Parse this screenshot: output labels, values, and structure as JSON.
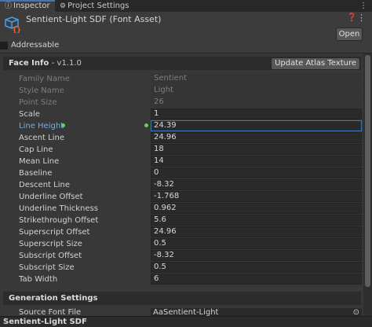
{
  "tabs": [
    {
      "label": "Inspector",
      "icon": "info-icon"
    },
    {
      "label": "Project Settings",
      "icon": "gear-icon"
    }
  ],
  "asset": {
    "title": "Sentient-Light SDF (Font Asset)",
    "open_label": "Open",
    "addressable_label": "Addressable",
    "addressable_checked": false
  },
  "face_info": {
    "title": "Face Info",
    "version": "- v1.1.0",
    "update_atlas_label": "Update Atlas Texture",
    "properties": [
      {
        "label": "Family Name",
        "value": "Sentient",
        "disabled": true
      },
      {
        "label": "Style Name",
        "value": "Light",
        "disabled": true
      },
      {
        "label": "Point Size",
        "value": "26",
        "disabled": true
      },
      {
        "label": "Scale",
        "value": "1"
      },
      {
        "label": "Line Height",
        "value": "24.39",
        "selected": true
      },
      {
        "label": "Ascent Line",
        "value": "24.96"
      },
      {
        "label": "Cap Line",
        "value": "18"
      },
      {
        "label": "Mean Line",
        "value": "14"
      },
      {
        "label": "Baseline",
        "value": "0"
      },
      {
        "label": "Descent Line",
        "value": "-8.32"
      },
      {
        "label": "Underline Offset",
        "value": "-1.768"
      },
      {
        "label": "Underline Thickness",
        "value": "0.962"
      },
      {
        "label": "Strikethrough Offset",
        "value": "5.6"
      },
      {
        "label": "Superscript Offset",
        "value": "24.96"
      },
      {
        "label": "Superscript Size",
        "value": "0.5"
      },
      {
        "label": "Subscript Offset",
        "value": "-8.32"
      },
      {
        "label": "Subscript Size",
        "value": "0.5"
      },
      {
        "label": "Tab Width",
        "value": "6"
      }
    ]
  },
  "generation": {
    "title": "Generation Settings",
    "source_font_label": "Source Font File",
    "source_font_value": "Sentient-Light"
  },
  "footer": {
    "label": "Sentient-Light SDF"
  },
  "colors": {
    "background": "#383838",
    "selected_label": "#7aa9e6",
    "selected_border": "#3e73b4",
    "override_dot": "#5fd35f"
  }
}
